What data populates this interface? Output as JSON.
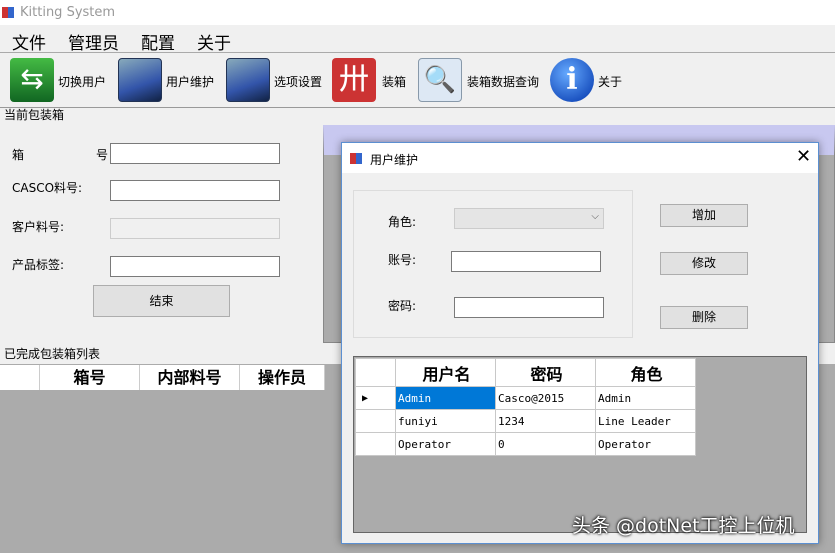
{
  "window": {
    "title": "Kitting System"
  },
  "menu": [
    "文件",
    "管理员",
    "配置",
    "关于"
  ],
  "toolbar": [
    {
      "label": "切换用户",
      "icon": "switch-user-icon"
    },
    {
      "label": "用户维护",
      "icon": "image-icon"
    },
    {
      "label": "选项设置",
      "icon": "image-icon"
    },
    {
      "label": "装箱",
      "icon": "packing-icon"
    },
    {
      "label": "装箱数据查询",
      "icon": "query-icon"
    },
    {
      "label": "关于",
      "icon": "info-icon"
    }
  ],
  "current_box": {
    "group_title": "当前包装箱",
    "box_label_a": "箱",
    "box_label_b": "号",
    "casco_label": "CASCO料号:",
    "customer_label": "客户料号:",
    "product_label": "产品标签:",
    "finish_button": "结束"
  },
  "completed": {
    "title": "已完成包装箱列表",
    "columns": [
      "箱号",
      "内部料号",
      "操作员"
    ]
  },
  "dialog": {
    "title": "用户维护",
    "role_label": "角色:",
    "account_label": "账号:",
    "password_label": "密码:",
    "add": "增加",
    "modify": "修改",
    "delete": "删除",
    "columns": [
      "用户名",
      "密码",
      "角色"
    ],
    "rows": [
      [
        "Admin",
        "Casco@2015",
        "Admin"
      ],
      [
        "funiyi",
        "1234",
        "Line Leader"
      ],
      [
        "Operator",
        "0",
        "Operator"
      ]
    ]
  },
  "watermark": "头条 @dotNet工控上位机"
}
